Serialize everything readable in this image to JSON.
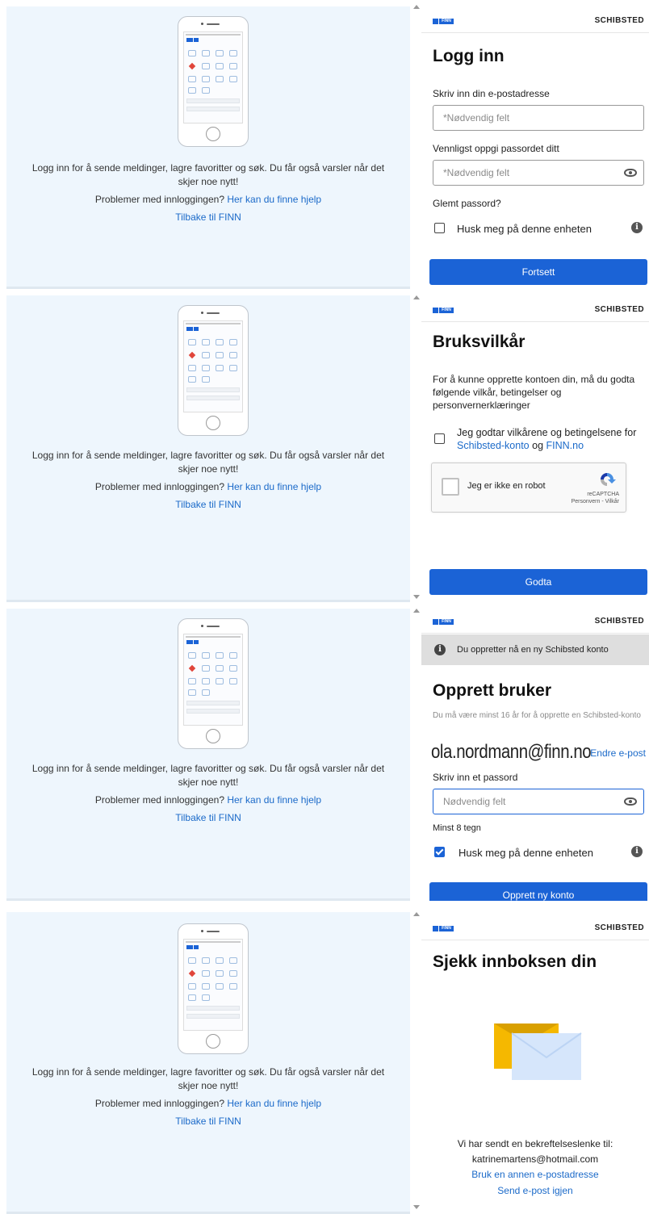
{
  "left": {
    "message": "Logg inn for å sende meldinger, lagre favoritter og søk. Du får også varsler når det skjer noe nytt!",
    "help_prefix": "Problemer med innloggingen?",
    "help_link": "Her kan du finne hjelp",
    "back_link": "Tilbake til FINN"
  },
  "header": {
    "logo": "FINN",
    "brand": "SCHIBSTED"
  },
  "login": {
    "title": "Logg inn",
    "email_label": "Skriv inn din e-postadresse",
    "email_placeholder": "*Nødvendig felt",
    "password_label": "Vennligst oppgi passordet ditt",
    "password_placeholder": "*Nødvendig felt",
    "forgot": "Glemt passord?",
    "remember": "Husk meg på denne enheten",
    "remember_checked": false,
    "continue": "Fortsett"
  },
  "terms": {
    "title": "Bruksvilkår",
    "intro": "For å kunne opprette kontoen din, må du godta følgende vilkår, betingelser og personvernerklæringer",
    "accept_prefix": "Jeg godtar vilkårene og betingelsene for",
    "link1": "Schibsted-konto",
    "and": "og",
    "link2": "FINN.no",
    "captcha_label": "Jeg er ikke en robot",
    "captcha_brand": "reCAPTCHA",
    "captcha_terms": "Personvern - Vilkår",
    "button": "Godta"
  },
  "create": {
    "notice": "Du oppretter nå en ny Schibsted konto",
    "title": "Opprett bruker",
    "age_note": "Du må være minst 16 år for å opprette en Schibsted-konto",
    "email": "ola.nordmann@finn.no",
    "change_email": "Endre e-post",
    "password_label": "Skriv inn et passord",
    "password_placeholder": "Nødvendig felt",
    "min_chars": "Minst 8 tegn",
    "remember": "Husk meg på denne enheten",
    "remember_checked": true,
    "button": "Opprett ny konto"
  },
  "inbox": {
    "title": "Sjekk innboksen din",
    "sent_to": "Vi har sendt en bekreftelseslenke til:",
    "address": "katrinemartens@hotmail.com",
    "other_address": "Bruk en annen e-postadresse",
    "resend": "Send e-post igjen"
  },
  "colors": {
    "accent": "#1b63d6",
    "left_bg": "#eef6fd",
    "link": "#1b6ac9"
  },
  "icons": [
    "phone-illustration",
    "eye-icon",
    "info-icon",
    "recaptcha-logo",
    "envelope-illustration"
  ]
}
